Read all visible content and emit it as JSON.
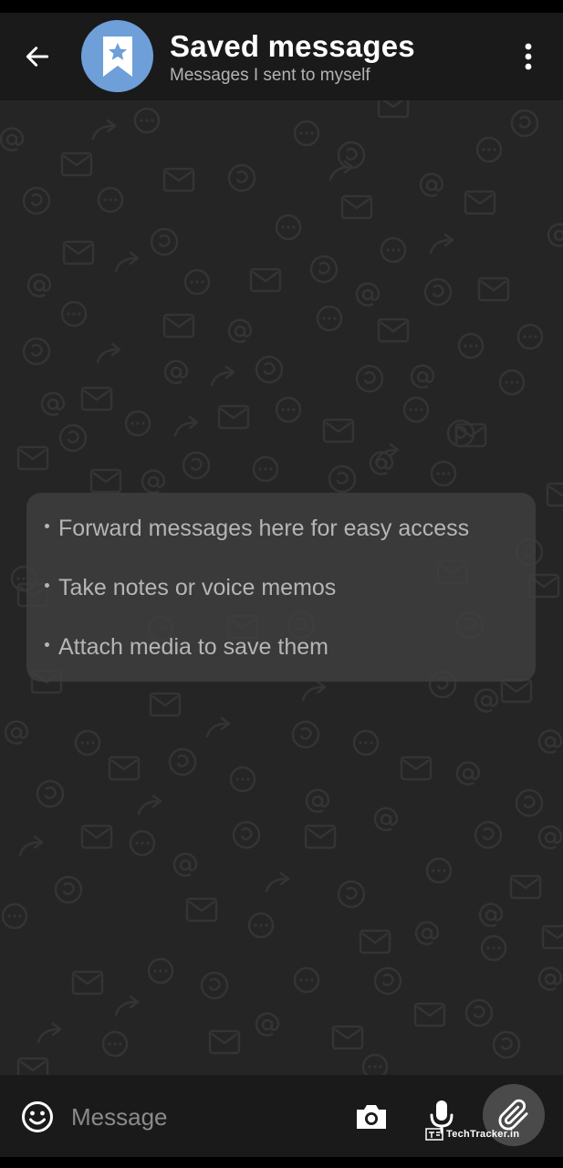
{
  "header": {
    "title": "Saved messages",
    "subtitle": "Messages I sent to myself",
    "avatar_color": "#6e9fd8"
  },
  "info_card": {
    "items": [
      "Forward messages here for easy access",
      "Take notes or voice memos",
      "Attach media to save them"
    ]
  },
  "input_bar": {
    "placeholder": "Message"
  },
  "icons": {
    "back": "arrow-left-icon",
    "avatar": "bookmark-star-icon",
    "menu": "more-vertical-icon",
    "emoji": "smiley-icon",
    "camera": "camera-icon",
    "mic": "microphone-icon",
    "attach": "paperclip-icon"
  },
  "watermark": {
    "text": "TechTracker.in"
  },
  "colors": {
    "header_bg": "#1a1a1a",
    "chat_bg": "#252525",
    "card_bg": "#404040",
    "attach_button_bg": "#4a4a4a"
  }
}
